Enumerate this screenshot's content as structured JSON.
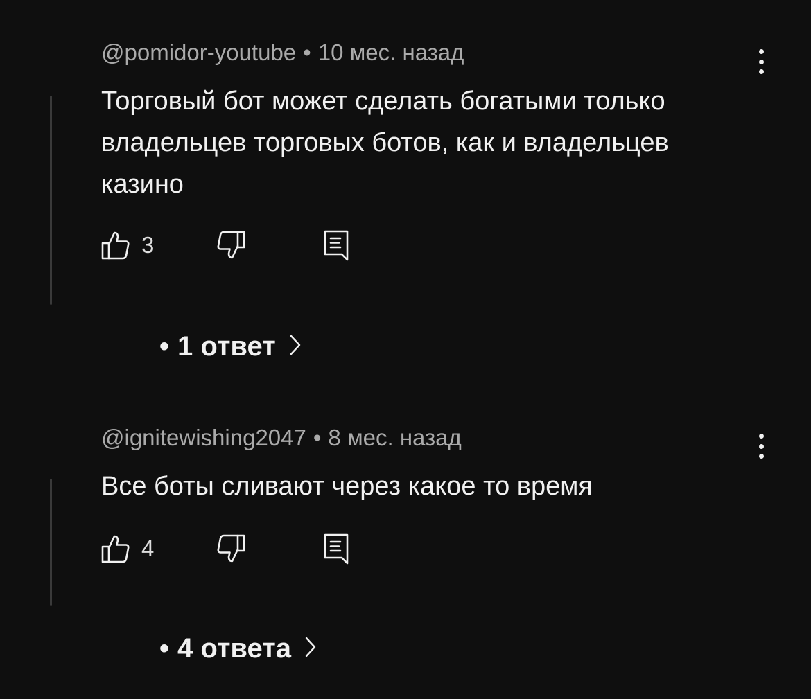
{
  "comments": [
    {
      "author": "@pomidor-youtube",
      "separator": "•",
      "time": "10 мес. назад",
      "text": "Торговый бот может сделать богатыми только владельцев торговых ботов, как и владельцев казино",
      "likes": "3",
      "replies_bullet": "•",
      "replies_label": "1 ответ"
    },
    {
      "author": "@ignitewishing2047",
      "separator": "•",
      "time": "8 мес. назад",
      "text": "Все боты сливают через какое то время",
      "likes": "4",
      "replies_bullet": "•",
      "replies_label": "4 ответа"
    }
  ],
  "icons": {
    "like": "thumbs-up-icon",
    "dislike": "thumbs-down-icon",
    "reply": "reply-comment-icon",
    "more": "more-vertical-icon",
    "chevron": "chevron-right-icon"
  },
  "colors": {
    "background": "#0f0f0f",
    "text_primary": "#f1f1f1",
    "text_secondary": "#aaaaaa",
    "thread_line": "#3a3a3a"
  }
}
